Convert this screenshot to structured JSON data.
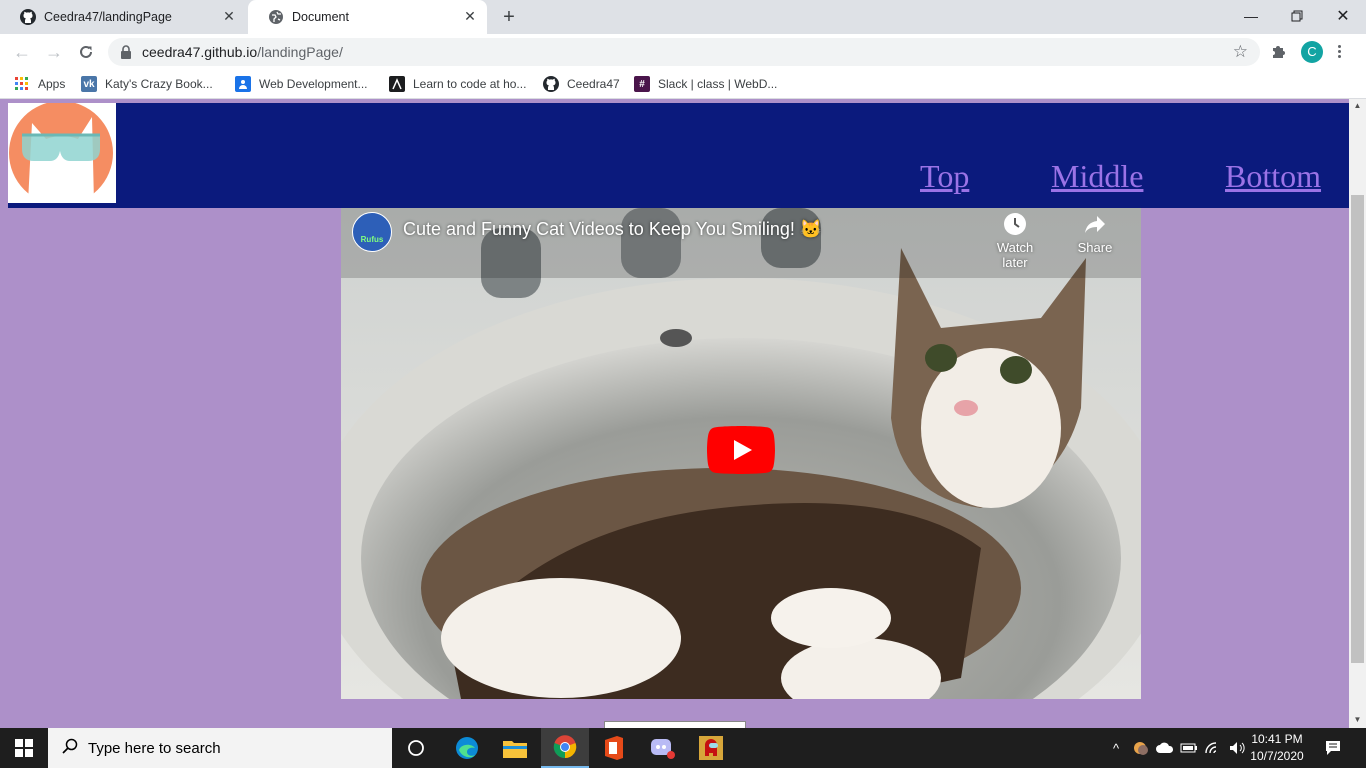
{
  "browser": {
    "tabs": [
      {
        "title": "Ceedra47/landingPage",
        "icon": "github-icon",
        "active": false
      },
      {
        "title": "Document",
        "icon": "globe-icon",
        "active": true
      }
    ],
    "url": {
      "host": "ceedra47.github.io",
      "path": "/landingPage/"
    },
    "profile_initial": "C",
    "bookmarks": [
      {
        "label": "Apps",
        "icon": "apps-grid-icon"
      },
      {
        "label": "Katy's Crazy Book...",
        "icon": "vk-icon"
      },
      {
        "label": "Web Development...",
        "icon": "classroom-icon"
      },
      {
        "label": "Learn to code at ho...",
        "icon": "code-icon"
      },
      {
        "label": "Ceedra47",
        "icon": "github-icon"
      },
      {
        "label": "Slack | class | WebD...",
        "icon": "slack-icon"
      }
    ]
  },
  "page": {
    "nav_links": [
      "Top",
      "Middle",
      "Bottom"
    ],
    "video": {
      "title": "Cute and Funny Cat Videos to Keep You Smiling! 🐱",
      "channel_icon_text": "Rufus",
      "watch_later": "Watch later",
      "share": "Share"
    },
    "colors": {
      "background": "#ad90c9",
      "navbar": "#0b1a7d",
      "link": "#9b73e6",
      "logo": "#f58d62"
    }
  },
  "taskbar": {
    "search_placeholder": "Type here to search",
    "time": "10:41 PM",
    "date": "10/7/2020"
  }
}
